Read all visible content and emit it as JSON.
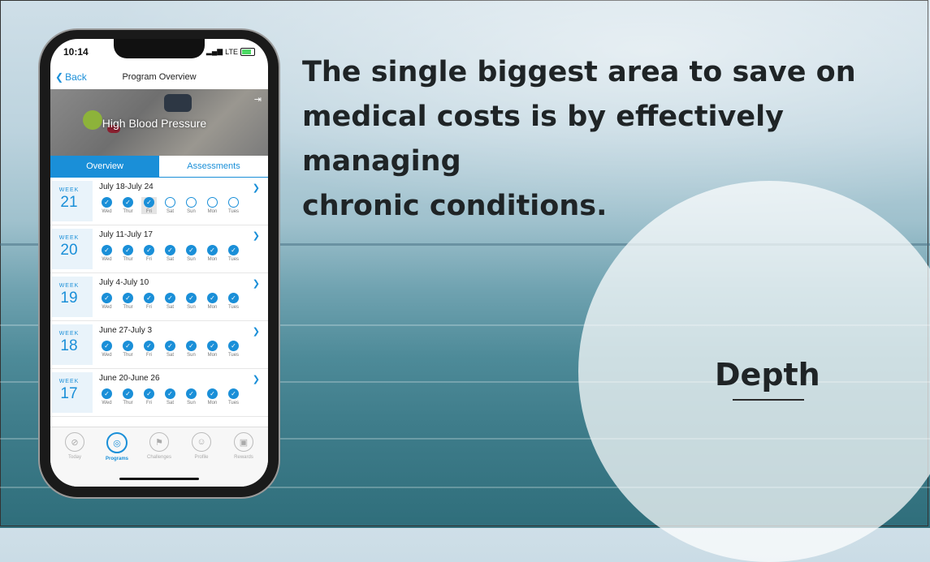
{
  "slide": {
    "headline": "The single biggest area to save on\nmedical costs is by effectively managing\nchronic conditions.",
    "circle_label": "Depth"
  },
  "phone": {
    "status": {
      "time": "10:14",
      "network": "LTE"
    },
    "nav": {
      "back_label": "Back",
      "title": "Program Overview"
    },
    "hero_title": "High Blood Pressure",
    "tabs": [
      {
        "label": "Overview",
        "active": true
      },
      {
        "label": "Assessments",
        "active": false
      }
    ],
    "weeks": [
      {
        "label": "WEEK",
        "number": "21",
        "range": "July 18-July 24",
        "days": [
          {
            "name": "Wed",
            "done": true
          },
          {
            "name": "Thur",
            "done": true
          },
          {
            "name": "Fri",
            "done": true,
            "selected": true
          },
          {
            "name": "Sat",
            "done": false
          },
          {
            "name": "Sun",
            "done": false
          },
          {
            "name": "Mon",
            "done": false
          },
          {
            "name": "Tues",
            "done": false
          }
        ]
      },
      {
        "label": "WEEK",
        "number": "20",
        "range": "July 11-July 17",
        "days": [
          {
            "name": "Wed",
            "done": true
          },
          {
            "name": "Thur",
            "done": true
          },
          {
            "name": "Fri",
            "done": true
          },
          {
            "name": "Sat",
            "done": true
          },
          {
            "name": "Sun",
            "done": true
          },
          {
            "name": "Mon",
            "done": true
          },
          {
            "name": "Tues",
            "done": true
          }
        ]
      },
      {
        "label": "WEEK",
        "number": "19",
        "range": "July 4-July 10",
        "days": [
          {
            "name": "Wed",
            "done": true
          },
          {
            "name": "Thur",
            "done": true
          },
          {
            "name": "Fri",
            "done": true
          },
          {
            "name": "Sat",
            "done": true
          },
          {
            "name": "Sun",
            "done": true
          },
          {
            "name": "Mon",
            "done": true
          },
          {
            "name": "Tues",
            "done": true
          }
        ]
      },
      {
        "label": "WEEK",
        "number": "18",
        "range": "June 27-July 3",
        "days": [
          {
            "name": "Wed",
            "done": true
          },
          {
            "name": "Thur",
            "done": true
          },
          {
            "name": "Fri",
            "done": true
          },
          {
            "name": "Sat",
            "done": true
          },
          {
            "name": "Sun",
            "done": true
          },
          {
            "name": "Mon",
            "done": true
          },
          {
            "name": "Tues",
            "done": true
          }
        ]
      },
      {
        "label": "WEEK",
        "number": "17",
        "range": "June 20-June 26",
        "days": [
          {
            "name": "Wed",
            "done": true
          },
          {
            "name": "Thur",
            "done": true
          },
          {
            "name": "Fri",
            "done": true
          },
          {
            "name": "Sat",
            "done": true
          },
          {
            "name": "Sun",
            "done": true
          },
          {
            "name": "Mon",
            "done": true
          },
          {
            "name": "Tues",
            "done": true
          }
        ]
      }
    ],
    "bottom_nav": [
      {
        "label": "Today",
        "icon": "compass-icon",
        "active": false
      },
      {
        "label": "Programs",
        "icon": "target-icon",
        "active": true
      },
      {
        "label": "Challenges",
        "icon": "flags-icon",
        "active": false
      },
      {
        "label": "Profile",
        "icon": "profile-icon",
        "active": false
      },
      {
        "label": "Rewards",
        "icon": "treasure-icon",
        "active": false
      }
    ]
  },
  "colors": {
    "accent": "#1a8fd8",
    "text_dark": "#1f2426"
  }
}
